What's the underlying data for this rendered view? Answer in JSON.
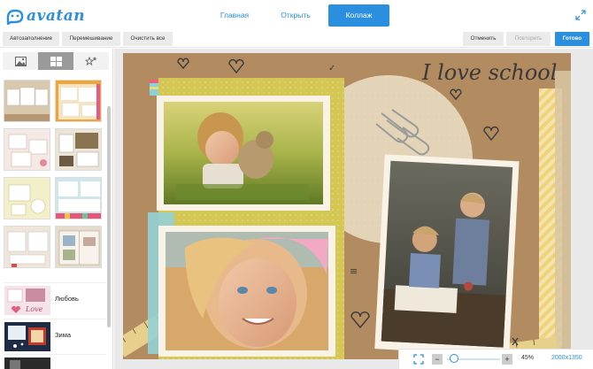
{
  "header": {
    "logo_text": "avatan",
    "nav": [
      {
        "label": "Главная"
      },
      {
        "label": "Открыть"
      },
      {
        "label": "Коллаж"
      }
    ]
  },
  "toolbar": {
    "autofill": "Автозаполнение",
    "shuffle": "Перемешивание",
    "clear_all": "Очистить все",
    "undo": "Отменить",
    "redo": "Повторить",
    "done": "Готово"
  },
  "sidebar": {
    "tabs": [
      "image-icon",
      "grid-icon",
      "stars-icon"
    ],
    "active_tab": 1,
    "categories": [
      {
        "label": "Любовь"
      },
      {
        "label": "Зима"
      }
    ]
  },
  "collage": {
    "text": "I love school"
  },
  "zoom": {
    "minus": "−",
    "plus": "+",
    "level": "45%",
    "level_fraction": 0.1,
    "size": "2000x1350"
  },
  "colors": {
    "accent": "#2b8fe0",
    "kraft": "#b48d62"
  }
}
